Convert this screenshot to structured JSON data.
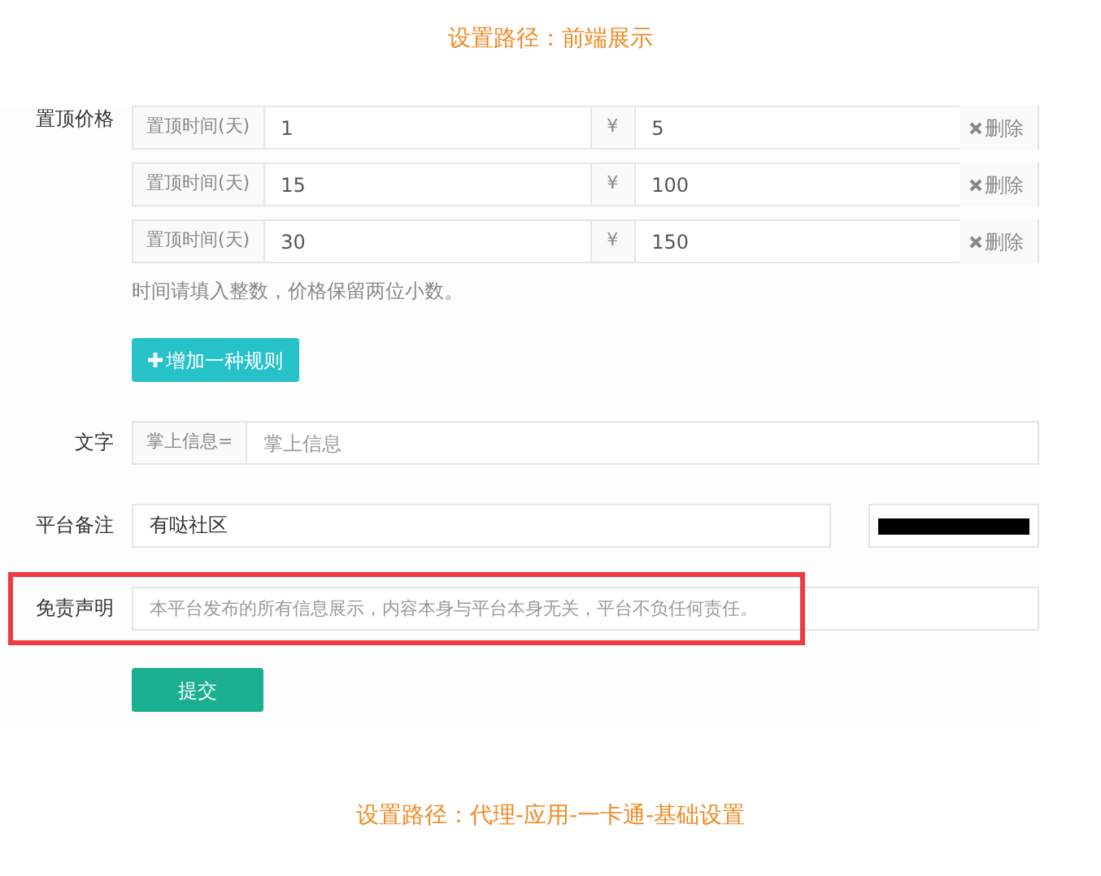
{
  "top_note": "设置路径：前端展示",
  "pricing": {
    "label": "置顶价格",
    "rows": [
      {
        "prefix": "置顶时间(天)",
        "days": "1",
        "currency": "¥",
        "price": "5",
        "delete": "删除"
      },
      {
        "prefix": "置顶时间(天)",
        "days": "15",
        "currency": "¥",
        "price": "100",
        "delete": "删除"
      },
      {
        "prefix": "置顶时间(天)",
        "days": "30",
        "currency": "¥",
        "price": "150",
        "delete": "删除"
      }
    ],
    "hint": "时间请填入整数，价格保留两位小数。",
    "add_button": "增加一种规则"
  },
  "text_field": {
    "label": "文字",
    "prefix": "掌上信息=",
    "placeholder": "掌上信息"
  },
  "platform_note": {
    "label": "平台备注",
    "value": "有哒社区",
    "redacted": true
  },
  "disclaimer": {
    "label": "免责声明",
    "placeholder": "本平台发布的所有信息展示，内容本身与平台本身无关，平台不负任何责任。",
    "highlighted": true
  },
  "submit_button": "提交",
  "bottom_note": "设置路径：代理-应用-一卡通-基础设置"
}
